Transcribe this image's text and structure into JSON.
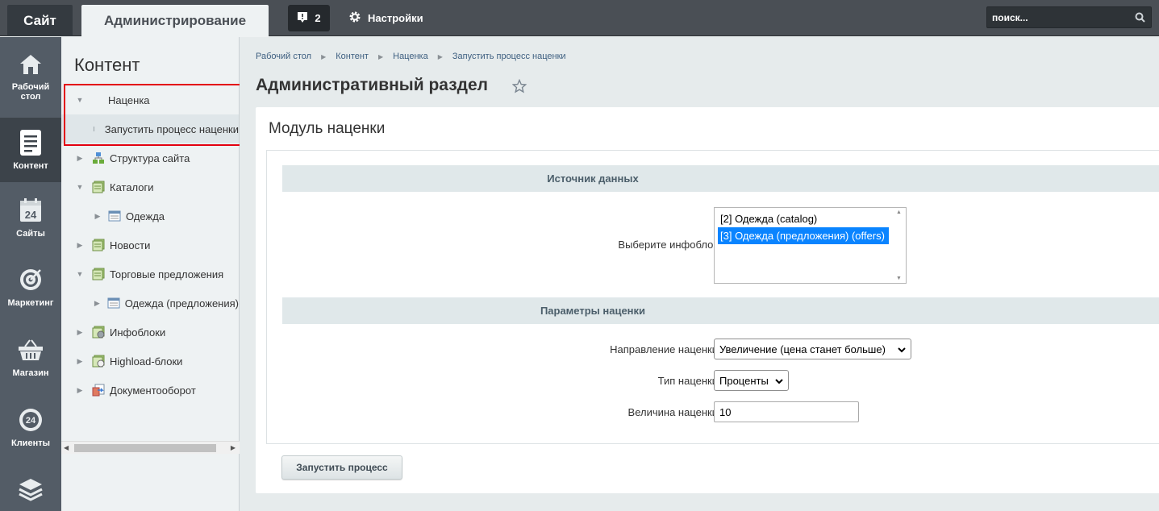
{
  "topbar": {
    "site_tab": "Сайт",
    "admin_tab": "Администрирование",
    "notifications_count": "2",
    "settings_label": "Настройки",
    "search_placeholder": "поиск..."
  },
  "iconbar": {
    "items": [
      {
        "label": "Рабочий стол",
        "icon": "home-icon"
      },
      {
        "label": "Контент",
        "icon": "content-icon"
      },
      {
        "label": "Сайты",
        "icon": "sites-icon"
      },
      {
        "label": "Маркетинг",
        "icon": "target-icon"
      },
      {
        "label": "Магазин",
        "icon": "basket-icon"
      },
      {
        "label": "Клиенты",
        "icon": "clients-icon"
      },
      {
        "label": "",
        "icon": "layers-icon"
      }
    ]
  },
  "tree": {
    "title": "Контент",
    "items": [
      {
        "label": "Наценка"
      },
      {
        "label": "Запустить процесс наценки"
      },
      {
        "label": "Структура сайта"
      },
      {
        "label": "Каталоги"
      },
      {
        "label": "Одежда"
      },
      {
        "label": "Новости"
      },
      {
        "label": "Торговые предложения"
      },
      {
        "label": "Одежда (предложения)"
      },
      {
        "label": "Инфоблоки"
      },
      {
        "label": "Highload-блоки"
      },
      {
        "label": "Документооборот"
      }
    ]
  },
  "breadcrumb": [
    "Рабочий стол",
    "Контент",
    "Наценка",
    "Запустить процесс наценки"
  ],
  "page_title": "Административный раздел",
  "card": {
    "title": "Модуль наценки",
    "section_source": "Источник данных",
    "iblock_label": "Выберите инфоблок",
    "iblock_options": [
      "[2] Одежда (catalog)",
      "[3] Одежда (предложения) (offers)"
    ],
    "iblock_selected_index": 1,
    "section_params": "Параметры наценки",
    "direction_label": "Направление наценки",
    "direction_value": "Увеличение (цена станет больше)",
    "type_label": "Тип наценки",
    "type_value": "Проценты",
    "amount_label": "Величина наценки",
    "amount_value": "10",
    "run_button": "Запустить процесс"
  }
}
